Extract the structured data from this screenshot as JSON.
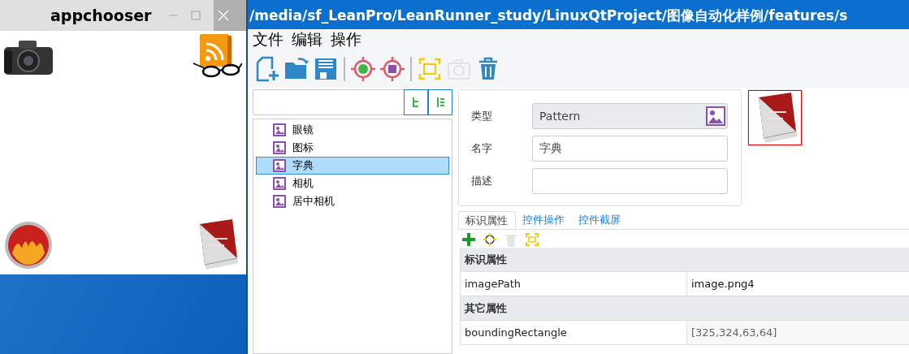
{
  "appchooser": {
    "title": "appchooser"
  },
  "main_window": {
    "title": "/media/sf_LeanPro/LeanRunner_study/LinuxQtProject/图像自动化样例/features/s",
    "menu": [
      "文件",
      "编辑",
      "操作"
    ],
    "toolbar": [
      {
        "kind": "new",
        "disabled": false
      },
      {
        "kind": "open",
        "disabled": false
      },
      {
        "kind": "save",
        "disabled": false
      },
      {
        "kind": "sep"
      },
      {
        "kind": "qt",
        "disabled": false
      },
      {
        "kind": "image",
        "disabled": false
      },
      {
        "kind": "sep"
      },
      {
        "kind": "capture",
        "disabled": false
      },
      {
        "kind": "camera",
        "disabled": true
      },
      {
        "kind": "trash",
        "disabled": false
      }
    ],
    "tree": [
      {
        "label": "眼镜",
        "selected": false
      },
      {
        "label": "图标",
        "selected": false
      },
      {
        "label": "字典",
        "selected": true
      },
      {
        "label": "相机",
        "selected": false
      },
      {
        "label": "居中相机",
        "selected": false
      }
    ],
    "form": [
      {
        "label": "类型",
        "value": "Pattern",
        "readonly": true
      },
      {
        "label": "名字",
        "value": "字典",
        "readonly": false
      },
      {
        "label": "描述",
        "readonly": false
      }
    ],
    "tabs": [
      {
        "label": "标识属性",
        "selected": true
      },
      {
        "label": "控件操作",
        "selected": false
      },
      {
        "label": "控件截屏",
        "selected": false
      }
    ],
    "prop_toolbar": [
      {
        "kind": "add",
        "disabled": false
      },
      {
        "kind": "locate",
        "disabled": false
      },
      {
        "kind": "trash",
        "disabled": true
      },
      {
        "kind": "capture",
        "disabled": false
      }
    ],
    "properties": [
      {
        "title": "标识属性",
        "rows": [
          {
            "name": "imagePath",
            "value": "image.png4",
            "readonly": false
          }
        ]
      },
      {
        "title": "其它属性",
        "rows": [
          {
            "name": "boundingRectangle",
            "value": "[325,324,63,64]",
            "readonly": true
          }
        ]
      }
    ]
  }
}
